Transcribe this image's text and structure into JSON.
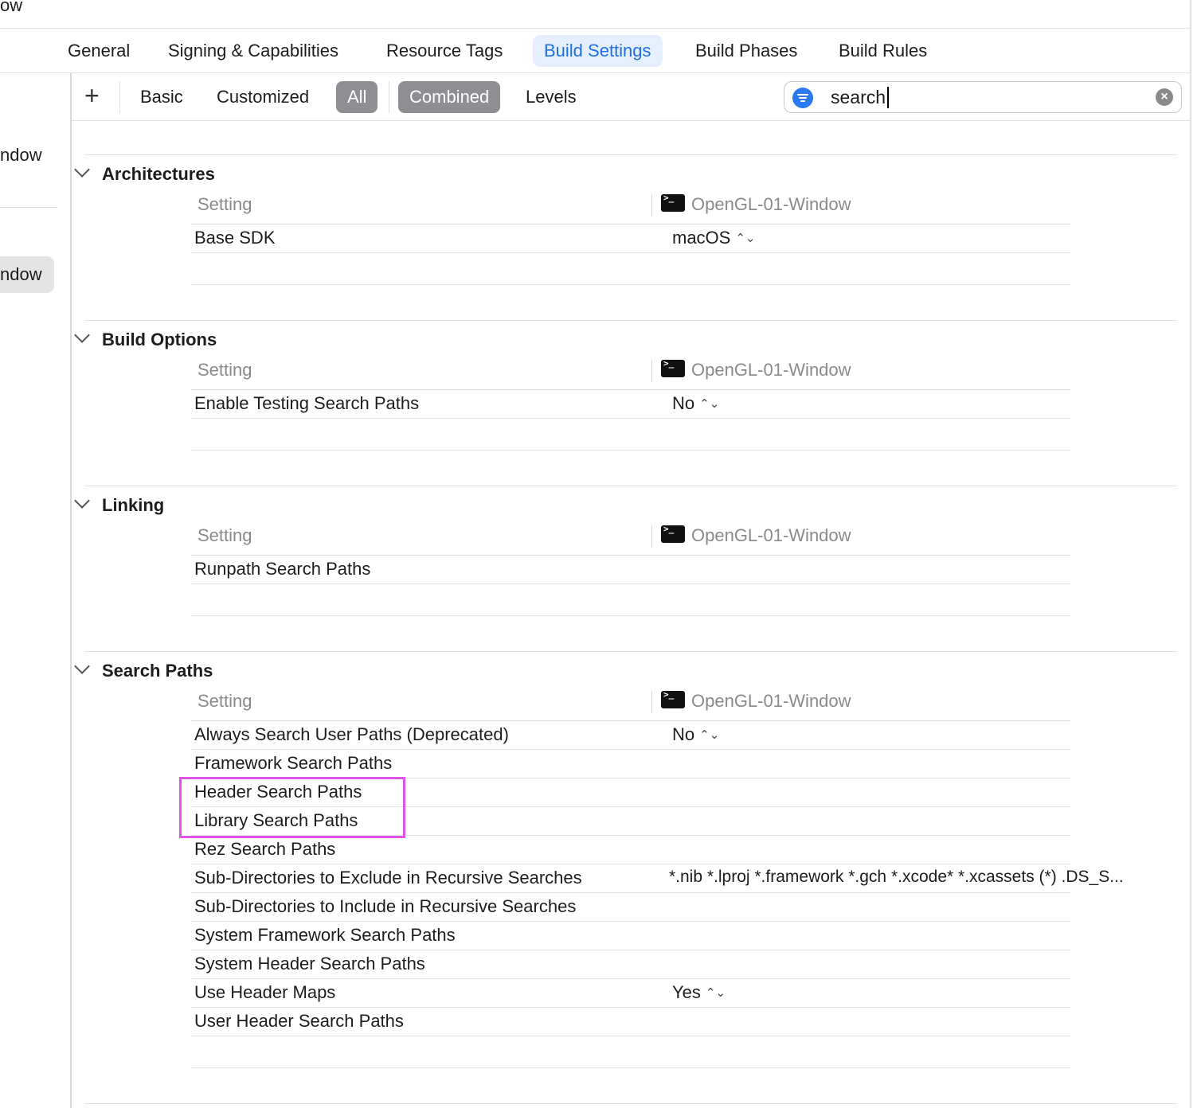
{
  "window": {
    "title_fragment": "ow"
  },
  "tabs": [
    {
      "label": "General",
      "active": false
    },
    {
      "label": "Signing & Capabilities",
      "active": false
    },
    {
      "label": "Resource Tags",
      "active": false
    },
    {
      "label": "Build Settings",
      "active": true
    },
    {
      "label": "Build Phases",
      "active": false
    },
    {
      "label": "Build Rules",
      "active": false
    }
  ],
  "sidebar": {
    "items": [
      {
        "label": "ndow",
        "selected": false
      },
      {
        "label": "ndow",
        "selected": true
      }
    ]
  },
  "toolbar": {
    "add_label": "+",
    "basic": "Basic",
    "customized": "Customized",
    "all": "All",
    "combined": "Combined",
    "levels": "Levels"
  },
  "search": {
    "value": "search",
    "placeholder": ""
  },
  "columns": {
    "setting": "Setting",
    "target": "OpenGL-01-Window"
  },
  "sections": [
    {
      "title": "Architectures",
      "rows": [
        {
          "name": "Base SDK",
          "value": "macOS",
          "popup": true
        }
      ]
    },
    {
      "title": "Build Options",
      "rows": [
        {
          "name": "Enable Testing Search Paths",
          "value": "No",
          "popup": true
        }
      ]
    },
    {
      "title": "Linking",
      "rows": [
        {
          "name": "Runpath Search Paths",
          "value": "",
          "popup": false
        }
      ]
    },
    {
      "title": "Search Paths",
      "rows": [
        {
          "name": "Always Search User Paths (Deprecated)",
          "value": "No",
          "popup": true
        },
        {
          "name": "Framework Search Paths",
          "value": "",
          "popup": false
        },
        {
          "name": "Header Search Paths",
          "value": "",
          "popup": false
        },
        {
          "name": "Library Search Paths",
          "value": "",
          "popup": false
        },
        {
          "name": "Rez Search Paths",
          "value": "",
          "popup": false
        },
        {
          "name": "Sub-Directories to Exclude in Recursive Searches",
          "value": "*.nib *.lproj *.framework *.gch *.xcode* *.xcassets (*) .DS_S...",
          "popup": false
        },
        {
          "name": "Sub-Directories to Include in Recursive Searches",
          "value": "",
          "popup": false
        },
        {
          "name": "System Framework Search Paths",
          "value": "",
          "popup": false
        },
        {
          "name": "System Header Search Paths",
          "value": "",
          "popup": false
        },
        {
          "name": "Use Header Maps",
          "value": "Yes",
          "popup": true
        },
        {
          "name": "User Header Search Paths",
          "value": "",
          "popup": false
        }
      ]
    }
  ],
  "colors": {
    "accent": "#1f6fe5",
    "active_tab_bg": "#e5effd",
    "toggle_bg": "#8e8e93",
    "highlight": "#e055e6"
  }
}
